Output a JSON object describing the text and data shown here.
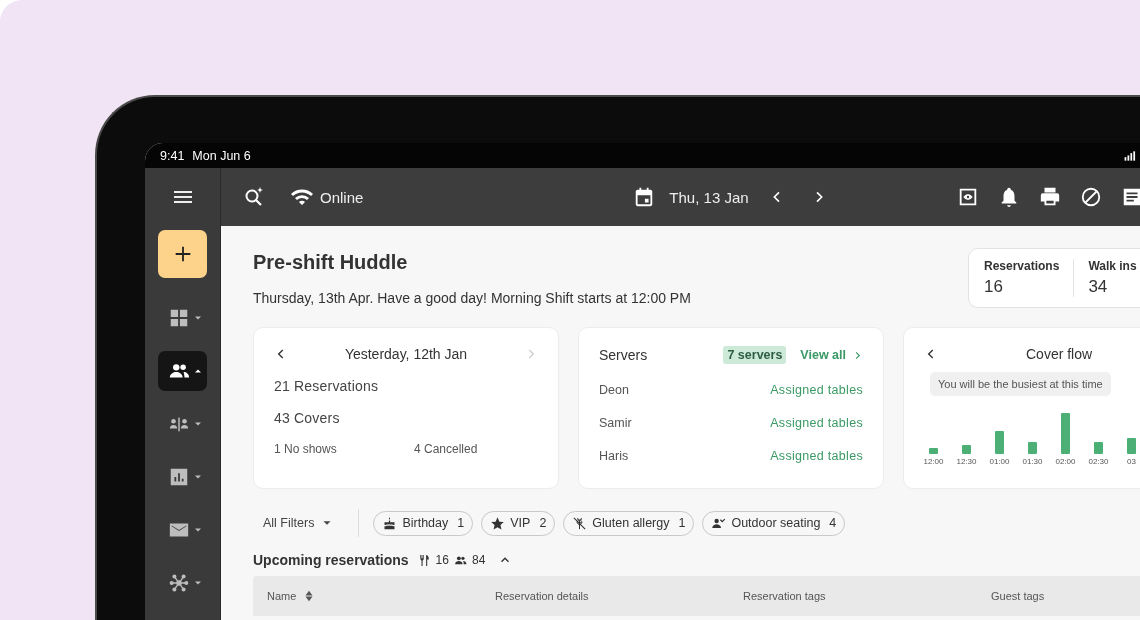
{
  "status_bar": {
    "time": "9:41",
    "date": "Mon Jun 6"
  },
  "top_bar": {
    "connection": "Online",
    "date": "Thu, 13 Jan"
  },
  "sidebar_items": [
    {
      "selected": false
    },
    {
      "selected": true
    },
    {
      "selected": false
    },
    {
      "selected": false
    },
    {
      "selected": false
    },
    {
      "selected": false
    }
  ],
  "huddle": {
    "title": "Pre-shift Huddle",
    "subtitle": "Thursday, 13th Apr. Have a good day! Morning Shift starts at 12:00 PM"
  },
  "stats": [
    {
      "label": "Reservations",
      "value": "16"
    },
    {
      "label": "Walk ins",
      "value": "34"
    }
  ],
  "summary_card": {
    "date": "Yesterday, 12th Jan",
    "next_disabled": true,
    "reservations": "21 Reservations",
    "covers": "43 Covers",
    "no_shows": "1 No shows",
    "cancelled": "4 Cancelled"
  },
  "servers_card": {
    "title": "Servers",
    "count": "7 servers",
    "link": "View all",
    "servers": [
      {
        "name": "Deon",
        "action": "Assigned tables"
      },
      {
        "name": "Samir",
        "action": "Assigned tables"
      },
      {
        "name": "Haris",
        "action": "Assigned tables"
      }
    ]
  },
  "cover_flow": {
    "title": "Cover flow",
    "tooltip": "You will be the busiest at this time",
    "times": [
      "12:00",
      "12:30",
      "01:00",
      "01:30",
      "02:00",
      "02:30",
      "03"
    ]
  },
  "filters": {
    "all": "All Filters",
    "chips": [
      {
        "label": "Birthday",
        "count": "1"
      },
      {
        "label": "VIP",
        "count": "2"
      },
      {
        "label": "Gluten allergy",
        "count": "1"
      },
      {
        "label": "Outdoor seating",
        "count": "4"
      }
    ]
  },
  "upcoming": {
    "title": "Upcoming reservations",
    "reservations": "16",
    "covers": "84",
    "expanded": true
  },
  "table": {
    "columns": [
      {
        "label": "Name",
        "sortable": true
      },
      {
        "label": "Reservation details",
        "sortable": false
      },
      {
        "label": "Reservation tags",
        "sortable": false
      },
      {
        "label": "Guest tags",
        "sortable": false
      }
    ]
  }
}
